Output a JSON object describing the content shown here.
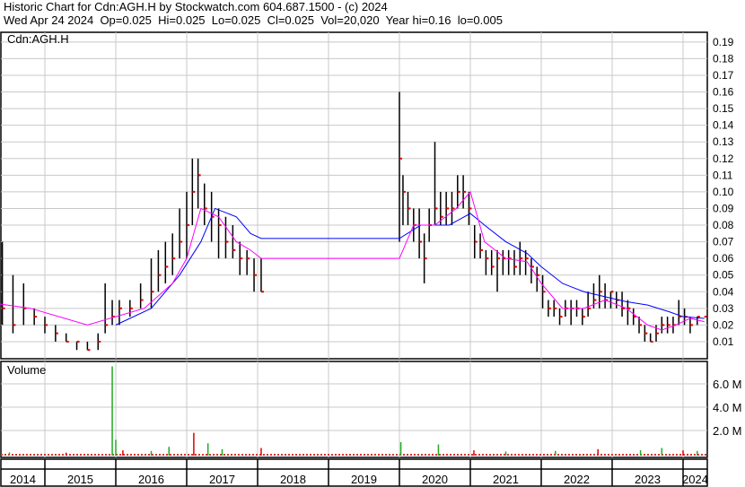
{
  "header": {
    "title": "Historic Chart for Cdn:AGH.H by Stockwatch.com 604.687.1500 - (c) 2024",
    "quote_line": "Wed Apr 24 2024  Op=0.025  Hi=0.025  Lo=0.025  Cl=0.025  Vol=20,020  Year hi=0.16  lo=0.005"
  },
  "chart_data": {
    "type": "line",
    "title": "Cdn:AGH.H",
    "price_axis": {
      "range": [
        0,
        0.2
      ],
      "ticks": [
        "0.01",
        "0.02",
        "0.03",
        "0.04",
        "0.05",
        "0.06",
        "0.07",
        "0.08",
        "0.09",
        "0.10",
        "0.11",
        "0.12",
        "0.13",
        "0.14",
        "0.15",
        "0.16",
        "0.17",
        "0.18",
        "0.19"
      ]
    },
    "volume_axis": {
      "label": "Volume",
      "range": [
        0,
        8000000
      ],
      "ticks": [
        {
          "v": 2000000,
          "label": "2.0 M"
        },
        {
          "v": 4000000,
          "label": "4.0 M"
        },
        {
          "v": 6000000,
          "label": "6.0 M"
        }
      ]
    },
    "x_axis": {
      "range": [
        2013.63,
        2024.35
      ],
      "year_labels": [
        "2014",
        "2015",
        "2016",
        "2017",
        "2018",
        "2019",
        "2020",
        "2021",
        "2022",
        "2023",
        "2024"
      ]
    },
    "grid": true,
    "price_bars": [
      [
        2013.65,
        0.05,
        0.04,
        0.075
      ],
      [
        2013.8,
        0.04,
        0.035,
        0.05
      ],
      [
        2013.95,
        0.035,
        0.03,
        0.045
      ],
      [
        2014.1,
        0.03,
        0.02,
        0.035
      ],
      [
        2014.25,
        0.02,
        0.02,
        0.025
      ],
      [
        2014.4,
        0.03,
        0.02,
        0.07
      ],
      [
        2014.55,
        0.02,
        0.015,
        0.05
      ],
      [
        2014.7,
        0.03,
        0.02,
        0.045
      ],
      [
        2014.85,
        0.025,
        0.02,
        0.03
      ],
      [
        2015.0,
        0.02,
        0.015,
        0.025
      ],
      [
        2015.15,
        0.015,
        0.01,
        0.02
      ],
      [
        2015.3,
        0.01,
        0.01,
        0.015
      ],
      [
        2015.45,
        0.01,
        0.005,
        0.01
      ],
      [
        2015.6,
        0.005,
        0.005,
        0.01
      ],
      [
        2015.75,
        0.01,
        0.005,
        0.015
      ],
      [
        2015.85,
        0.02,
        0.015,
        0.045
      ],
      [
        2015.95,
        0.025,
        0.02,
        0.035
      ],
      [
        2016.05,
        0.03,
        0.02,
        0.035
      ],
      [
        2016.2,
        0.03,
        0.025,
        0.035
      ],
      [
        2016.35,
        0.035,
        0.03,
        0.045
      ],
      [
        2016.5,
        0.04,
        0.03,
        0.06
      ],
      [
        2016.6,
        0.05,
        0.04,
        0.065
      ],
      [
        2016.7,
        0.055,
        0.045,
        0.07
      ],
      [
        2016.8,
        0.06,
        0.05,
        0.075
      ],
      [
        2016.9,
        0.07,
        0.06,
        0.09
      ],
      [
        2017.0,
        0.08,
        0.06,
        0.1
      ],
      [
        2017.08,
        0.1,
        0.08,
        0.12
      ],
      [
        2017.16,
        0.11,
        0.09,
        0.12
      ],
      [
        2017.25,
        0.09,
        0.08,
        0.105
      ],
      [
        2017.35,
        0.085,
        0.07,
        0.1
      ],
      [
        2017.45,
        0.08,
        0.06,
        0.09
      ],
      [
        2017.55,
        0.07,
        0.06,
        0.085
      ],
      [
        2017.65,
        0.065,
        0.06,
        0.08
      ],
      [
        2017.75,
        0.06,
        0.05,
        0.07
      ],
      [
        2017.85,
        0.06,
        0.05,
        0.065
      ],
      [
        2017.95,
        0.05,
        0.04,
        0.06
      ],
      [
        2018.05,
        0.04,
        0.04,
        0.06
      ],
      [
        2020.0,
        0.12,
        0.07,
        0.16
      ],
      [
        2020.05,
        0.1,
        0.08,
        0.11
      ],
      [
        2020.12,
        0.09,
        0.08,
        0.1
      ],
      [
        2020.2,
        0.08,
        0.07,
        0.09
      ],
      [
        2020.28,
        0.07,
        0.06,
        0.09
      ],
      [
        2020.35,
        0.06,
        0.045,
        0.075
      ],
      [
        2020.42,
        0.08,
        0.07,
        0.09
      ],
      [
        2020.5,
        0.09,
        0.08,
        0.13
      ],
      [
        2020.58,
        0.085,
        0.08,
        0.1
      ],
      [
        2020.66,
        0.09,
        0.08,
        0.1
      ],
      [
        2020.74,
        0.09,
        0.08,
        0.1
      ],
      [
        2020.82,
        0.1,
        0.09,
        0.11
      ],
      [
        2020.9,
        0.1,
        0.09,
        0.11
      ],
      [
        2020.98,
        0.09,
        0.08,
        0.1
      ],
      [
        2021.06,
        0.07,
        0.06,
        0.08
      ],
      [
        2021.14,
        0.065,
        0.06,
        0.075
      ],
      [
        2021.22,
        0.06,
        0.05,
        0.065
      ],
      [
        2021.3,
        0.055,
        0.05,
        0.065
      ],
      [
        2021.38,
        0.06,
        0.04,
        0.065
      ],
      [
        2021.46,
        0.06,
        0.05,
        0.065
      ],
      [
        2021.54,
        0.06,
        0.05,
        0.065
      ],
      [
        2021.62,
        0.055,
        0.05,
        0.065
      ],
      [
        2021.7,
        0.06,
        0.05,
        0.07
      ],
      [
        2021.78,
        0.06,
        0.05,
        0.065
      ],
      [
        2021.86,
        0.055,
        0.045,
        0.06
      ],
      [
        2021.94,
        0.05,
        0.04,
        0.055
      ],
      [
        2022.02,
        0.04,
        0.03,
        0.05
      ],
      [
        2022.1,
        0.03,
        0.025,
        0.035
      ],
      [
        2022.18,
        0.03,
        0.025,
        0.035
      ],
      [
        2022.26,
        0.025,
        0.02,
        0.03
      ],
      [
        2022.34,
        0.03,
        0.025,
        0.035
      ],
      [
        2022.42,
        0.03,
        0.02,
        0.035
      ],
      [
        2022.5,
        0.03,
        0.025,
        0.035
      ],
      [
        2022.58,
        0.025,
        0.02,
        0.03
      ],
      [
        2022.66,
        0.03,
        0.025,
        0.04
      ],
      [
        2022.74,
        0.035,
        0.03,
        0.045
      ],
      [
        2022.82,
        0.04,
        0.03,
        0.05
      ],
      [
        2022.9,
        0.035,
        0.03,
        0.045
      ],
      [
        2022.98,
        0.04,
        0.03,
        0.04
      ],
      [
        2023.06,
        0.035,
        0.03,
        0.04
      ],
      [
        2023.14,
        0.03,
        0.025,
        0.04
      ],
      [
        2023.22,
        0.03,
        0.02,
        0.035
      ],
      [
        2023.3,
        0.025,
        0.02,
        0.03
      ],
      [
        2023.38,
        0.02,
        0.015,
        0.025
      ],
      [
        2023.46,
        0.015,
        0.01,
        0.02
      ],
      [
        2023.54,
        0.01,
        0.01,
        0.015
      ],
      [
        2023.62,
        0.015,
        0.01,
        0.02
      ],
      [
        2023.7,
        0.02,
        0.015,
        0.025
      ],
      [
        2023.78,
        0.02,
        0.015,
        0.025
      ],
      [
        2023.86,
        0.02,
        0.015,
        0.025
      ],
      [
        2023.94,
        0.025,
        0.02,
        0.035
      ],
      [
        2024.02,
        0.025,
        0.02,
        0.03
      ],
      [
        2024.1,
        0.02,
        0.015,
        0.025
      ],
      [
        2024.2,
        0.025,
        0.02,
        0.025
      ],
      [
        2024.3,
        0.025,
        0.025,
        0.025
      ]
    ],
    "series": [
      {
        "name": "moving-average-long",
        "color": "#0000ff",
        "points": [
          [
            2016.0,
            0.02
          ],
          [
            2016.5,
            0.03
          ],
          [
            2016.9,
            0.05
          ],
          [
            2017.2,
            0.07
          ],
          [
            2017.4,
            0.09
          ],
          [
            2017.7,
            0.085
          ],
          [
            2017.9,
            0.075
          ],
          [
            2018.05,
            0.072
          ],
          [
            2020.0,
            0.072
          ],
          [
            2020.3,
            0.08
          ],
          [
            2020.7,
            0.08
          ],
          [
            2021.0,
            0.087
          ],
          [
            2021.2,
            0.08
          ],
          [
            2021.5,
            0.07
          ],
          [
            2021.8,
            0.063
          ],
          [
            2022.0,
            0.055
          ],
          [
            2022.3,
            0.045
          ],
          [
            2022.6,
            0.04
          ],
          [
            2022.9,
            0.037
          ],
          [
            2023.2,
            0.034
          ],
          [
            2023.5,
            0.032
          ],
          [
            2023.8,
            0.028
          ],
          [
            2024.0,
            0.025
          ],
          [
            2024.3,
            0.024
          ]
        ]
      },
      {
        "name": "moving-average-short",
        "color": "#ff00ff",
        "points": [
          [
            2014.3,
            0.033
          ],
          [
            2014.8,
            0.03
          ],
          [
            2015.2,
            0.025
          ],
          [
            2015.6,
            0.02
          ],
          [
            2016.0,
            0.025
          ],
          [
            2016.4,
            0.03
          ],
          [
            2016.8,
            0.045
          ],
          [
            2017.0,
            0.06
          ],
          [
            2017.2,
            0.09
          ],
          [
            2017.45,
            0.085
          ],
          [
            2017.7,
            0.07
          ],
          [
            2017.9,
            0.065
          ],
          [
            2018.05,
            0.06
          ],
          [
            2020.0,
            0.06
          ],
          [
            2020.2,
            0.08
          ],
          [
            2020.5,
            0.08
          ],
          [
            2020.8,
            0.09
          ],
          [
            2021.0,
            0.1
          ],
          [
            2021.2,
            0.07
          ],
          [
            2021.5,
            0.06
          ],
          [
            2021.8,
            0.058
          ],
          [
            2022.0,
            0.045
          ],
          [
            2022.3,
            0.03
          ],
          [
            2022.6,
            0.03
          ],
          [
            2022.9,
            0.035
          ],
          [
            2023.2,
            0.03
          ],
          [
            2023.5,
            0.02
          ],
          [
            2023.7,
            0.017
          ],
          [
            2023.9,
            0.02
          ],
          [
            2024.1,
            0.024
          ],
          [
            2024.3,
            0.022
          ]
        ]
      }
    ],
    "volume_bars": [
      [
        2013.7,
        150000
      ],
      [
        2014.5,
        120000
      ],
      [
        2015.3,
        100000
      ],
      [
        2015.95,
        7500000
      ],
      [
        2016.0,
        1200000
      ],
      [
        2016.1,
        300000
      ],
      [
        2016.5,
        250000
      ],
      [
        2016.75,
        600000
      ],
      [
        2017.1,
        1800000
      ],
      [
        2017.3,
        900000
      ],
      [
        2017.5,
        400000
      ],
      [
        2018.05,
        500000
      ],
      [
        2020.02,
        1000000
      ],
      [
        2020.55,
        800000
      ],
      [
        2021.05,
        300000
      ],
      [
        2021.5,
        200000
      ],
      [
        2022.2,
        250000
      ],
      [
        2022.8,
        400000
      ],
      [
        2023.4,
        300000
      ],
      [
        2023.7,
        500000
      ],
      [
        2024.0,
        300000
      ],
      [
        2024.2,
        250000
      ]
    ]
  }
}
